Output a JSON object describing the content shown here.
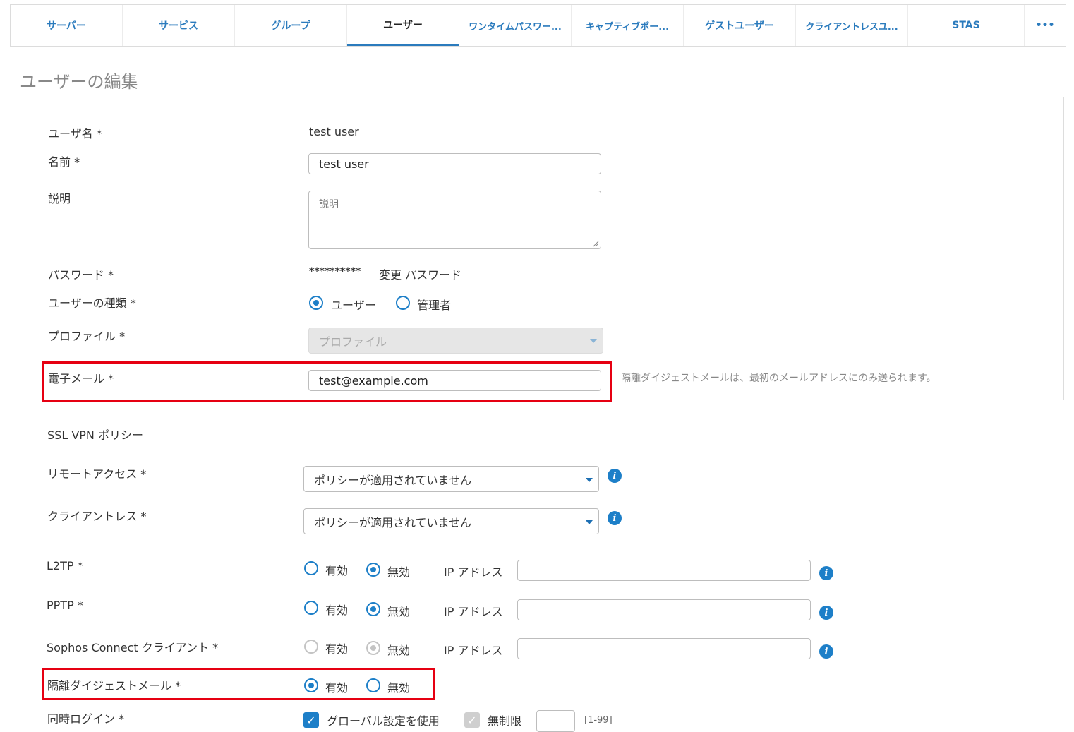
{
  "tabs": [
    {
      "label": "サーバー"
    },
    {
      "label": "サービス"
    },
    {
      "label": "グループ"
    },
    {
      "label": "ユーザー"
    },
    {
      "label": "ワンタイムパスワー..."
    },
    {
      "label": "キャプティブポー..."
    },
    {
      "label": "ゲストユーザー"
    },
    {
      "label": "クライアントレスユ..."
    },
    {
      "label": "STAS"
    },
    {
      "label": "•••"
    }
  ],
  "page_title": "ユーザーの編集",
  "form": {
    "username_label": "ユーザ名 *",
    "username_value": "test user",
    "name_label": "名前 *",
    "name_value": "test user",
    "description_label": "説明",
    "description_placeholder": "説明",
    "password_label": "パスワード *",
    "password_mask": "**********",
    "password_change_link": "変更 パスワード",
    "user_type_label": "ユーザーの種類 *",
    "user_type_options": [
      "ユーザー",
      "管理者"
    ],
    "profile_label": "プロファイル *",
    "profile_placeholder": "プロファイル",
    "email_label": "電子メール *",
    "email_value": "test@example.com",
    "email_hint": "隔離ダイジェストメールは、最初のメールアドレスにのみ送られます。"
  },
  "ssl_vpn": {
    "section_title": "SSL VPN ポリシー",
    "remote_access_label": "リモートアクセス *",
    "remote_access_value": "ポリシーが適用されていません",
    "clientless_label": "クライアントレス *",
    "clientless_value": "ポリシーが適用されていません"
  },
  "vpn_rows": {
    "enabled_label": "有効",
    "disabled_label": "無効",
    "ip_label": "IP アドレス",
    "l2tp_label": "L2TP *",
    "pptp_label": "PPTP *",
    "sophos_label": "Sophos Connect クライアント *"
  },
  "quarantine": {
    "label": "隔離ダイジェストメール *",
    "enabled_label": "有効",
    "disabled_label": "無効"
  },
  "concurrent": {
    "label": "同時ログイン *",
    "use_global_label": "グローバル設定を使用",
    "unlimited_label": "無制限",
    "range_label": "[1-99]"
  },
  "icons": {
    "info": "i",
    "check": "✓"
  },
  "colors": {
    "accent": "#1d7fc8",
    "highlight": "#e60012"
  }
}
